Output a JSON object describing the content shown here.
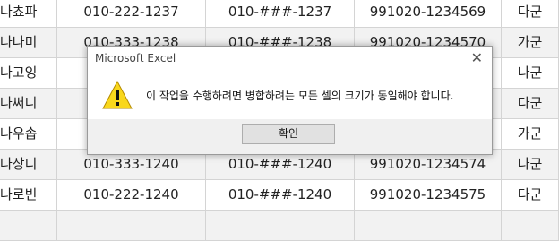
{
  "sheet": {
    "rows": [
      {
        "name": "나쵸파",
        "phone": "010-222-1237",
        "masked": "010-###-1237",
        "id": "991020-1234569",
        "unit": "다군"
      },
      {
        "name": "나나미",
        "phone": "010-333-1238",
        "masked": "010-###-1238",
        "id": "991020-1234570",
        "unit": "가군"
      },
      {
        "name": "나고잉",
        "phone": "",
        "masked": "",
        "id": "",
        "unit": "나군"
      },
      {
        "name": "나써니",
        "phone": "",
        "masked": "",
        "id": "",
        "unit": "다군"
      },
      {
        "name": "나우솝",
        "phone": "",
        "masked": "",
        "id": "",
        "unit": "가군"
      },
      {
        "name": "나상디",
        "phone": "010-333-1240",
        "masked": "010-###-1240",
        "id": "991020-1234574",
        "unit": "나군"
      },
      {
        "name": "나로빈",
        "phone": "010-222-1240",
        "masked": "010-###-1240",
        "id": "991020-1234575",
        "unit": "다군"
      },
      {
        "name": "",
        "phone": "",
        "masked": "",
        "id": "",
        "unit": ""
      }
    ]
  },
  "dialog": {
    "title": "Microsoft Excel",
    "close_glyph": "✕",
    "message": "이 작업을 수행하려면 병합하려는 모든 셀의 크기가 동일해야 합니다.",
    "ok_label": "확인",
    "icon": "warning-icon",
    "warn_color": "#f9d71c"
  }
}
